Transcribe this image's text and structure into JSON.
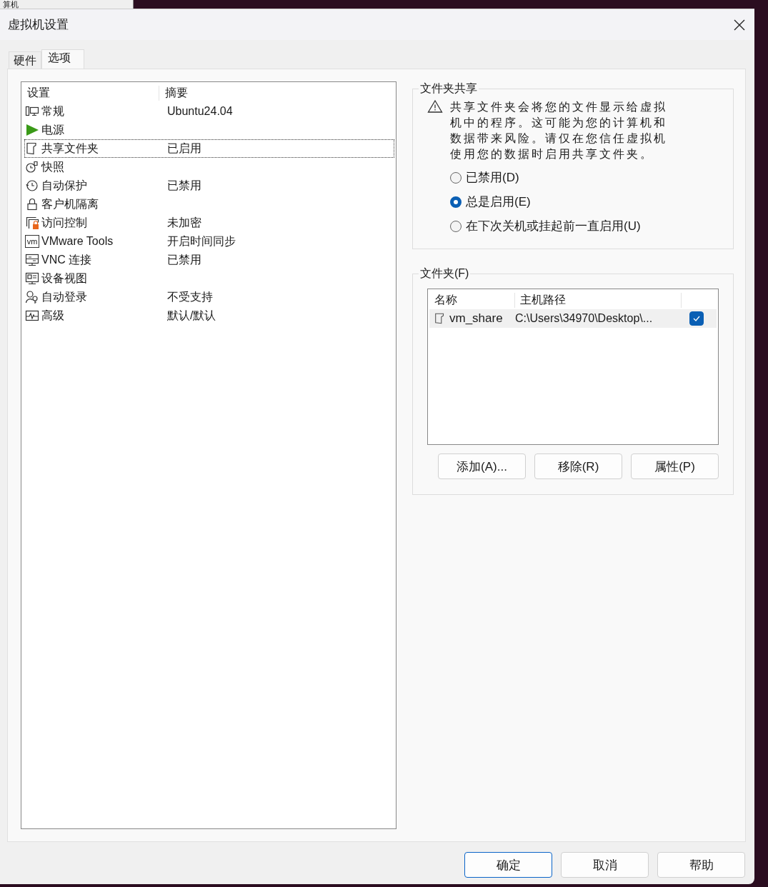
{
  "background_window": {
    "title": "算机"
  },
  "window": {
    "title": "虚拟机设置"
  },
  "tabs": [
    {
      "label": "硬件",
      "selected": false
    },
    {
      "label": "选项",
      "selected": true
    }
  ],
  "settings_list": {
    "columns": [
      "设置",
      "摘要"
    ],
    "rows": [
      {
        "name": "常规",
        "summary": "Ubuntu24.04",
        "selected": false
      },
      {
        "name": "电源",
        "selected": false
      },
      {
        "name": "共享文件夹",
        "summary": "已启用",
        "selected": true
      },
      {
        "name": "快照",
        "selected": false
      },
      {
        "name": "自动保护",
        "summary": "已禁用",
        "selected": false
      },
      {
        "name": "客户机隔离",
        "selected": false
      },
      {
        "name": "访问控制",
        "summary": "未加密",
        "selected": false
      },
      {
        "name": "VMware Tools",
        "icon_text": "vm",
        "summary": "开启时间同步",
        "selected": false
      },
      {
        "name": "VNC 连接",
        "summary": "已禁用",
        "selected": false
      },
      {
        "name": "设备视图",
        "selected": false
      },
      {
        "name": "自动登录",
        "summary": "不受支持",
        "selected": false
      },
      {
        "name": "高级",
        "summary": "默认/默认",
        "selected": false
      }
    ]
  },
  "sharing": {
    "title": "文件夹共享",
    "warning": "共享文件夹会将您的文件显示给虚拟机中的程序。这可能为您的计算机和数据带来风险。请仅在您信任虚拟机使用您的数据时启用共享文件夹。",
    "options": [
      {
        "label": "已禁用(D)",
        "selected": false
      },
      {
        "label": "总是启用(E)",
        "selected": true
      },
      {
        "label": "在下次关机或挂起前一直启用(U)",
        "selected": false
      }
    ]
  },
  "folders": {
    "title": "文件夹(F)",
    "columns": [
      "名称",
      "主机路径"
    ],
    "rows": [
      {
        "name": "vm_share",
        "path": "C:\\Users\\34970\\Desktop\\...",
        "enabled": true
      }
    ],
    "buttons": [
      "添加(A)...",
      "移除(R)",
      "属性(P)"
    ]
  },
  "footer_buttons": [
    {
      "label": "确定",
      "default": true
    },
    {
      "label": "取消",
      "default": false
    },
    {
      "label": "帮助",
      "default": false
    }
  ]
}
